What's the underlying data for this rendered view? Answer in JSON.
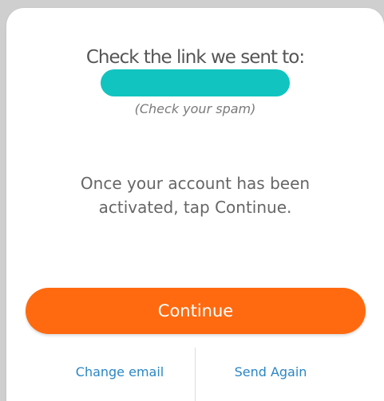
{
  "dialog": {
    "title": "Check the link we sent to:",
    "spam_note": "(Check your spam)",
    "instructions": "Once your account has been activated, tap Continue.",
    "continue_label": "Continue",
    "change_email_label": "Change email",
    "send_again_label": "Send Again"
  },
  "colors": {
    "accent_teal": "#11c4bf",
    "primary_orange": "#ff6a10",
    "link_blue": "#2a86c6"
  }
}
